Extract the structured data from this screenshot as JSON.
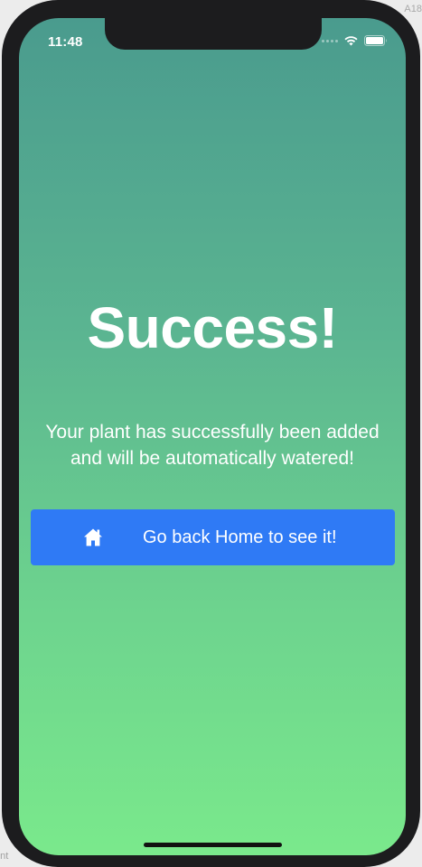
{
  "desktop": {
    "corner_text": "A18",
    "bottom_text": "ont"
  },
  "status_bar": {
    "time": "11:48",
    "icons": [
      "cellular-signal-icon",
      "wifi-icon",
      "battery-icon"
    ]
  },
  "screen": {
    "title": "Success!",
    "message_line1": "Your plant has successfully been added",
    "message_line2": "and will be automatically watered!",
    "home_button": {
      "label": "Go back Home to see it!",
      "icon": "home-icon"
    }
  },
  "colors": {
    "gradient_top": "#4a9b8e",
    "gradient_bottom": "#7ae98c",
    "button": "#2f7af5",
    "text": "#ffffff"
  }
}
